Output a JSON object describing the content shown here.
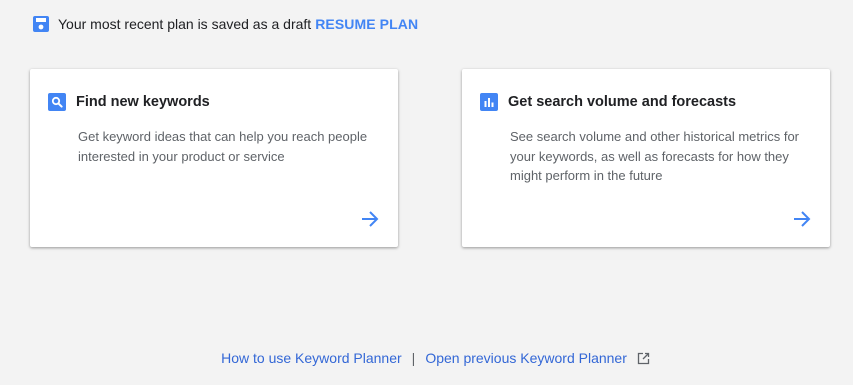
{
  "draft_banner": {
    "icon": "save-icon",
    "message": "Your most recent plan is saved as a draft",
    "resume_label": "RESUME PLAN"
  },
  "cards": [
    {
      "icon": "search-icon",
      "title": "Find new keywords",
      "description": "Get keyword ideas that can help you reach people interested in your product or service",
      "arrow_icon": "arrow-right-icon"
    },
    {
      "icon": "bar-chart-icon",
      "title": "Get search volume and forecasts",
      "description": "See search volume and other historical metrics for your keywords, as well as forecasts for how they might perform in the future",
      "arrow_icon": "arrow-right-icon"
    }
  ],
  "footer": {
    "how_to_label": "How to use Keyword Planner",
    "separator": "|",
    "previous_label": "Open previous Keyword Planner",
    "external_icon": "open-in-new-icon"
  },
  "colors": {
    "background": "#f3f3f3",
    "accent": "#4285f4",
    "link": "#3367d6",
    "text_primary": "#202124",
    "text_secondary": "#5f6368"
  }
}
